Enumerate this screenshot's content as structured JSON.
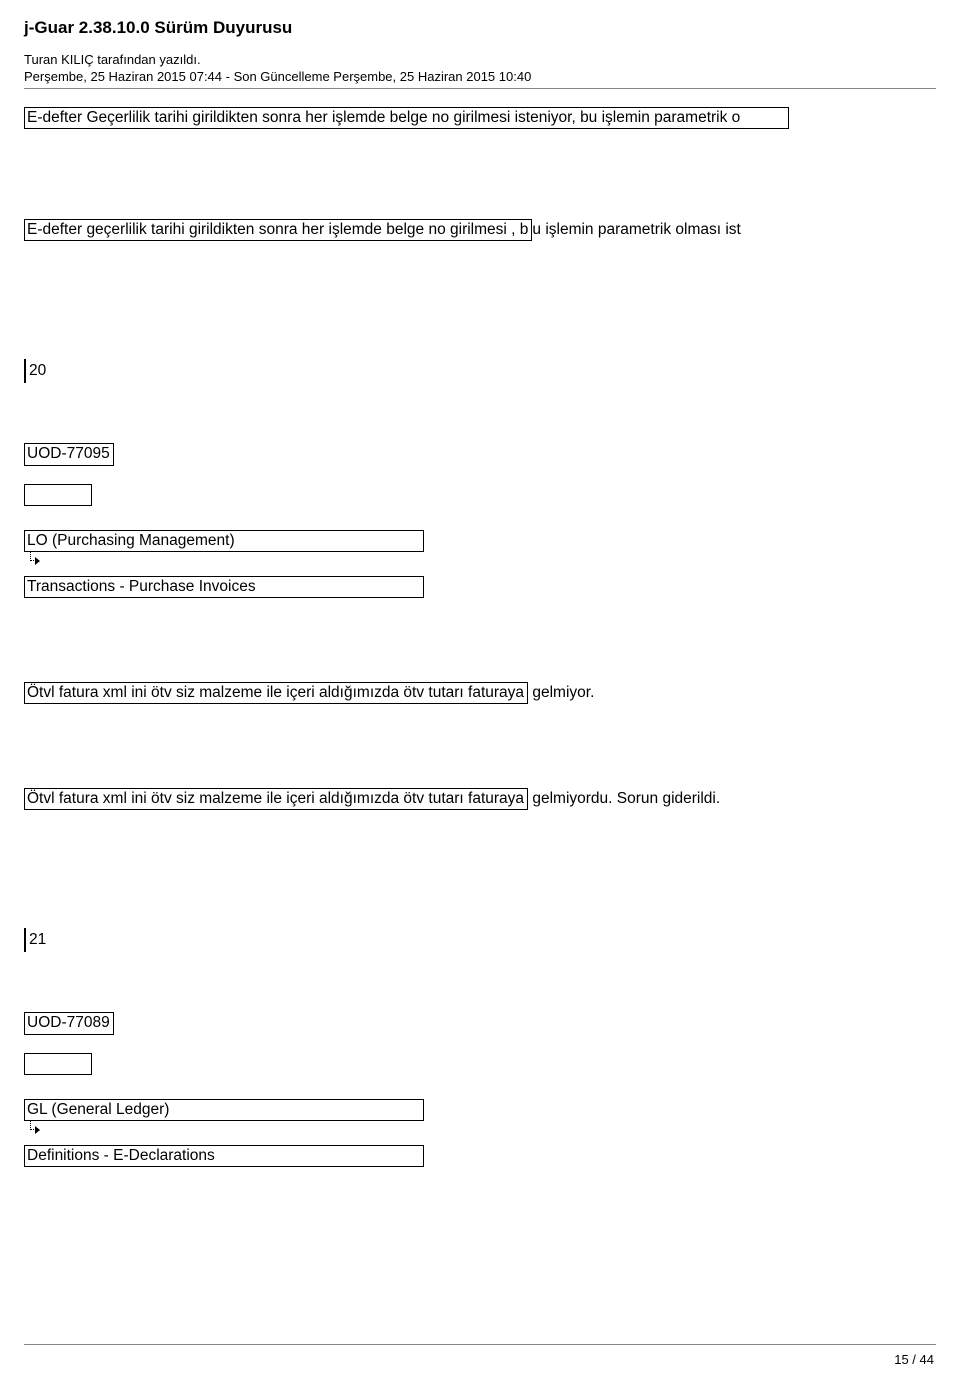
{
  "header": {
    "title": "j-Guar 2.38.10.0 Sürüm Duyurusu",
    "author": "Turan KILIÇ tarafından yazıldı.",
    "date_line": "Perşembe, 25 Haziran 2015 07:44 - Son Güncelleme Perşembe, 25 Haziran 2015 10:40"
  },
  "line1_boxed": "E-defter Geçerlilik tarihi girildikten sonra her işlemde belge no girilmesi isteniyor, bu işlemin parametrik o",
  "line2_boxed": "E-defter geçerlilik tarihi girildikten sonra her işlemde belge no girilmesi , b",
  "line2_tail": "u işlemin parametrik olması ist",
  "num_20": "20",
  "id_20": "UOD-77095",
  "module_20": "LO (Purchasing Management)",
  "trans_20": "Transactions - Purchase Invoices",
  "desc_20_boxed": "Ötvl fatura xml ini ötv siz malzeme ile içeri aldığımızda ötv tutarı faturaya",
  "desc_20_tail": " gelmiyor.",
  "fix_20_boxed": "Ötvl fatura xml ini ötv siz malzeme ile içeri aldığımızda ötv tutarı faturaya",
  "fix_20_tail": " gelmiyordu. Sorun giderildi.",
  "num_21": "21",
  "id_21": "UOD-77089",
  "module_21": "GL (General Ledger)",
  "trans_21": "Definitions - E-Declarations",
  "page_number": "15 / 44"
}
